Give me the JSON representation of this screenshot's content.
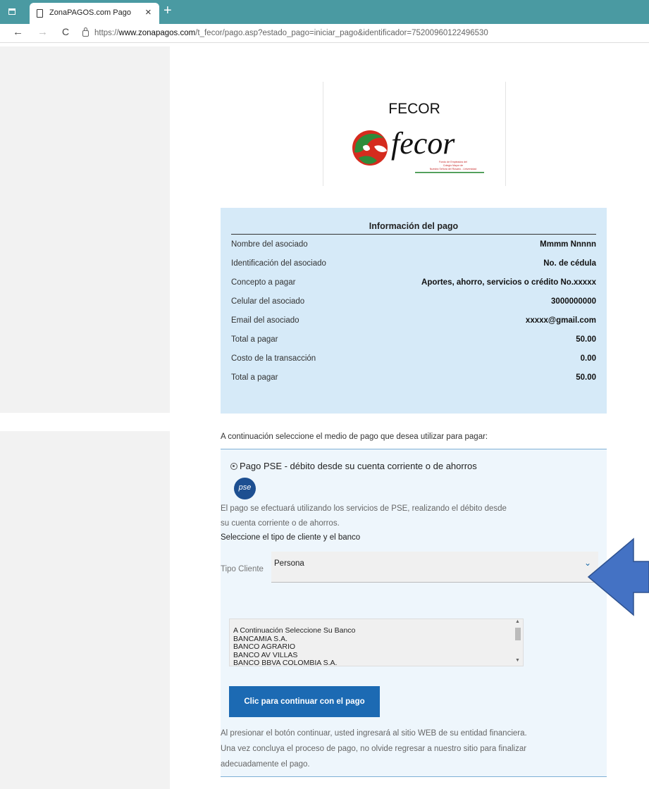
{
  "browser": {
    "tab_title": "ZonaPAGOS.com Pago",
    "tab_close": "×",
    "new_tab": "+",
    "back": "←",
    "forward": "→",
    "reload": "C",
    "url_prefix": "https://",
    "url_domain": "www.zonapagos.com",
    "url_path": "/t_fecor/pago.asp?estado_pago=iniciar_pago&identificador=75200960122496530"
  },
  "header": {
    "company": "FECOR",
    "logo_word": "fecor",
    "logo_tagline": [
      "Fondo de Empleados del",
      "Colegio Mayor de",
      "Nuestra Señora del Rosario - Universidad"
    ]
  },
  "payment_info": {
    "title": "Información del pago",
    "rows": [
      {
        "label": "Nombre del asociado",
        "value": "Mmmm Nnnnn"
      },
      {
        "label": "Identificación del asociado",
        "value": "No. de cédula"
      },
      {
        "label": "Concepto a pagar",
        "value": "Aportes, ahorro, servicios o crédito No.xxxxx"
      },
      {
        "label": "Celular del asociado",
        "value": "3000000000"
      },
      {
        "label": "Email del asociado",
        "value": "xxxxx@gmail.com"
      },
      {
        "label": "Total a pagar",
        "value": "50.00"
      },
      {
        "label": "Costo de la transacción",
        "value": "0.00"
      },
      {
        "label": "Total a pagar",
        "value": "50.00"
      }
    ]
  },
  "payment_method": {
    "intro": "A continuación seleccione el medio de pago que desea utilizar para pagar:",
    "pse_label": "Pago PSE - débito desde su cuenta corriente o de ahorros",
    "pse_logo": "pse",
    "desc_line1": "El pago se efectuará utilizando los servicios de PSE, realizando el débito desde",
    "desc_line2": "su cuenta corriente o de ahorros.",
    "subtitle": "Seleccione el tipo de cliente y el banco",
    "tipo_label": "Tipo Cliente",
    "tipo_value": "Persona",
    "chevron": "⌄",
    "banks": [
      "A Continuación Seleccione Su Banco",
      "BANCAMIA S.A.",
      "BANCO AGRARIO",
      "BANCO AV VILLAS",
      "BANCO BBVA COLOMBIA S.A."
    ],
    "button": "Clic para continuar con el pago",
    "note_line1": "Al presionar el botón continuar, usted ingresará al sitio WEB de su entidad financiera.",
    "note_line2": "Una vez concluya el proceso de pago, no olvide regresar a nuestro sitio para finalizar",
    "note_line3": "adecuadamente el pago."
  },
  "colors": {
    "tab_bar": "#4a9aa2",
    "info_panel": "#d6eaf8",
    "select_panel": "#eef6fc",
    "button": "#1c6ab3",
    "arrow": "#4472c4"
  },
  "icons": [
    "window-icon",
    "page-icon",
    "lock-icon",
    "pse-logo-icon",
    "left-arrow-icon"
  ]
}
